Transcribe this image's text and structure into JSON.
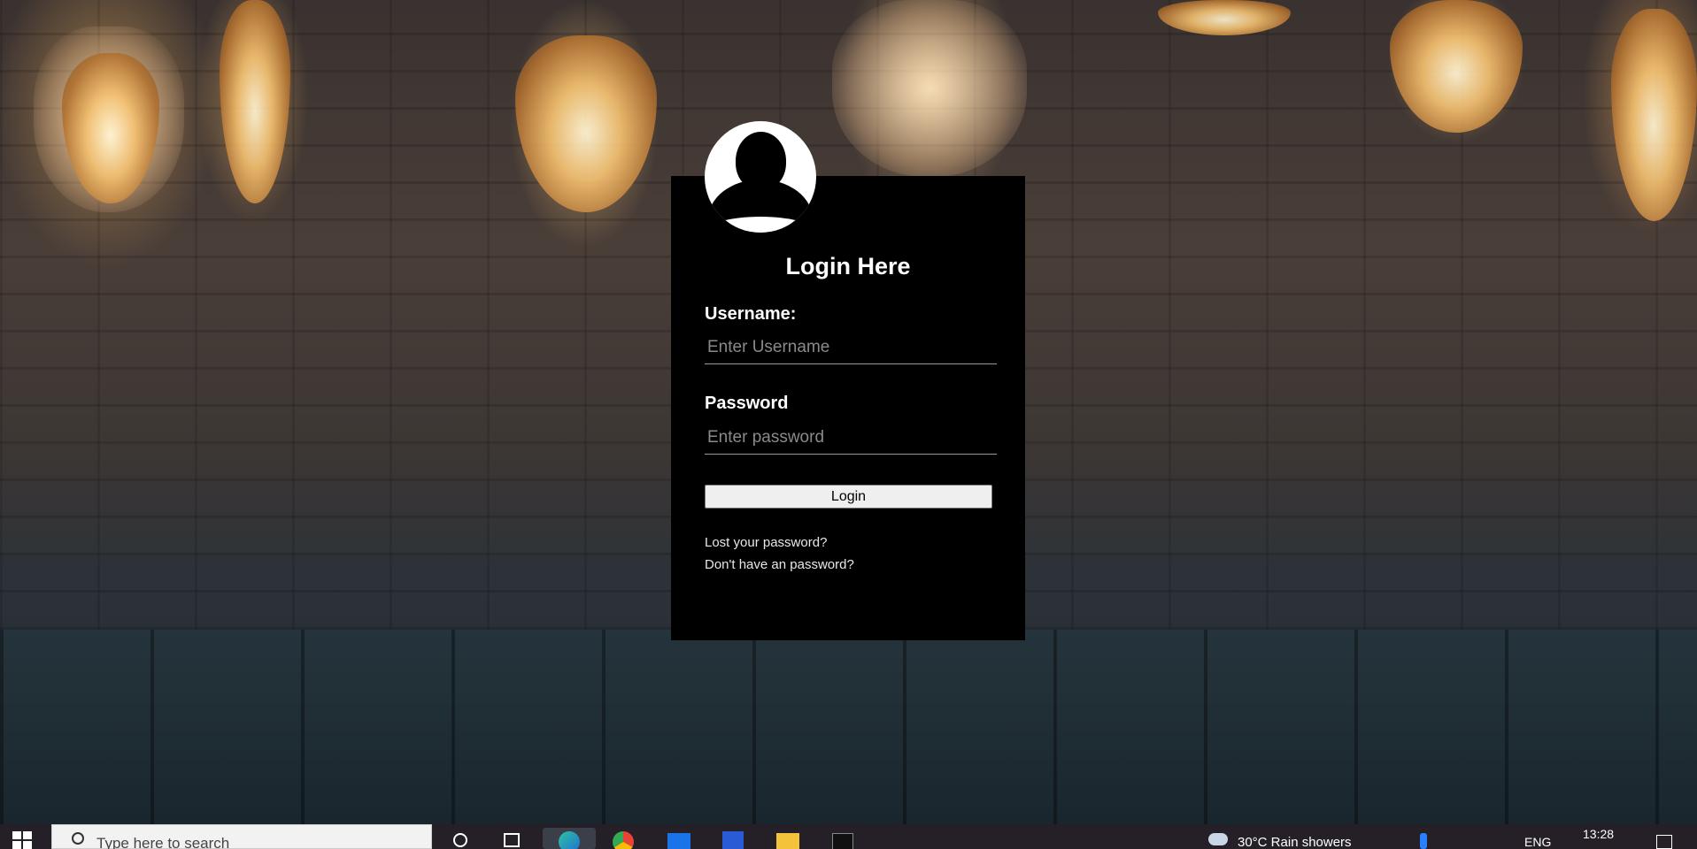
{
  "login": {
    "title": "Login Here",
    "username_label": "Username:",
    "username_placeholder": "Enter Username",
    "password_label": "Password",
    "password_placeholder": "Enter password",
    "login_button": "Login",
    "lost_password_link": "Lost your password?",
    "no_password_link": "Don't have an password?"
  },
  "taskbar": {
    "search_placeholder": "Type here to search",
    "weather": "30°C  Rain showers",
    "language": "ENG",
    "time": "13:28",
    "apps": [
      "start-icon",
      "cortana-icon",
      "task-view-icon",
      "edge-icon",
      "chrome-icon",
      "mail-icon",
      "app-icon",
      "file-explorer-icon",
      "terminal-icon"
    ]
  },
  "colors": {
    "card_bg": "#000000",
    "text": "#ffffff",
    "taskbar_bg": "#252028"
  }
}
